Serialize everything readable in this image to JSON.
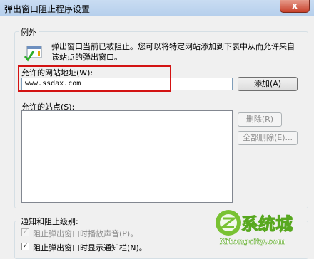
{
  "window": {
    "title": "弹出窗口阻止程序设置",
    "close_glyph": "x"
  },
  "exceptions": {
    "group_label": "例外",
    "info_text": "弹出窗口当前已被阻止。您可以将特定网站添加到下表中从而允许来自该站点的弹出窗口。",
    "address_label": "允许的网站地址(W):",
    "address_value": "www.ssdax.com",
    "add_button": "添加(A)",
    "allowed_sites_label": "允许的站点(S):",
    "remove_button": "删除(R)",
    "remove_all_button": "全部删除(E)..."
  },
  "notify": {
    "group_label": "通知和阻止级别:",
    "play_sound_label": "阻止弹出窗口时播放声音(P)。",
    "show_bar_label": "阻止弹出窗口时显示通知栏(N)。"
  },
  "watermark": {
    "text": "系统城",
    "subtext": "Xitongcity.com"
  }
}
